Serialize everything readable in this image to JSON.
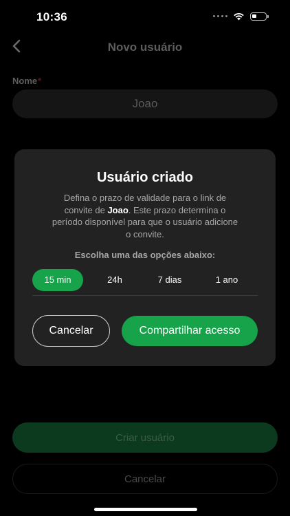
{
  "status_bar": {
    "time": "10:36"
  },
  "header": {
    "title": "Novo usuário"
  },
  "form": {
    "name_label": "Nome",
    "required_mark": "*",
    "name_value": "Joao",
    "create_button": "Criar usuário",
    "cancel_button": "Cancelar"
  },
  "modal": {
    "title": "Usuário criado",
    "desc_before": "Defina o prazo de validade para o link de convite de ",
    "user_name": "Joao",
    "desc_after": ". Este prazo determina o período disponível para que o usuário adicione o convite.",
    "choose_label": "Escolha uma das opções abaixo:",
    "options": [
      {
        "label": "15 min",
        "selected": true
      },
      {
        "label": "24h",
        "selected": false
      },
      {
        "label": "7 dias",
        "selected": false
      },
      {
        "label": "1 ano",
        "selected": false
      }
    ],
    "cancel_button": "Cancelar",
    "share_button": "Compartilhar acesso"
  },
  "colors": {
    "accent": "#16a34a",
    "modal_bg": "#222222",
    "background": "#000000"
  },
  "icons": {
    "back": "chevron-left-icon",
    "wifi": "wifi-icon",
    "battery": "battery-icon",
    "signal": "signal-icon"
  }
}
